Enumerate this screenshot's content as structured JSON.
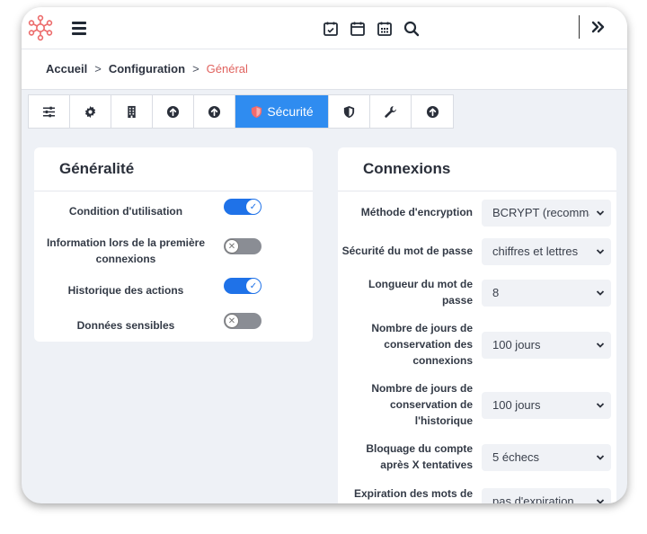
{
  "breadcrumb": {
    "home": "Accueil",
    "config": "Configuration",
    "current": "Général",
    "separator": ">"
  },
  "toolbar": {
    "active_label": "Sécurité"
  },
  "general": {
    "title": "Généralité",
    "items": [
      {
        "label": "Condition d'utilisation",
        "enabled": true
      },
      {
        "label": "Information lors de la première connexions",
        "enabled": false
      },
      {
        "label": "Historique des actions",
        "enabled": true
      },
      {
        "label": "Données sensibles",
        "enabled": false
      }
    ]
  },
  "connections": {
    "title": "Connexions",
    "fields": [
      {
        "label": "Méthode d'encryption",
        "value": "BCRYPT (recommandé)"
      },
      {
        "label": "Sécurité du mot de passe",
        "value": "chiffres et lettres"
      },
      {
        "label": "Longueur du mot de passe",
        "value": "8"
      },
      {
        "label": "Nombre de jours de conservation des connexions",
        "value": "100 jours"
      },
      {
        "label": "Nombre de jours de conservation de l'historique",
        "value": "100 jours"
      },
      {
        "label": "Bloquage du compte après X tentatives",
        "value": "5 échecs"
      },
      {
        "label": "Expiration des mots de",
        "value": "pas d'expiration"
      }
    ]
  },
  "colors": {
    "accent": "#2f8cf0",
    "toggle_on": "#1f72e8",
    "breadcrumb_current": "#e0625e"
  }
}
